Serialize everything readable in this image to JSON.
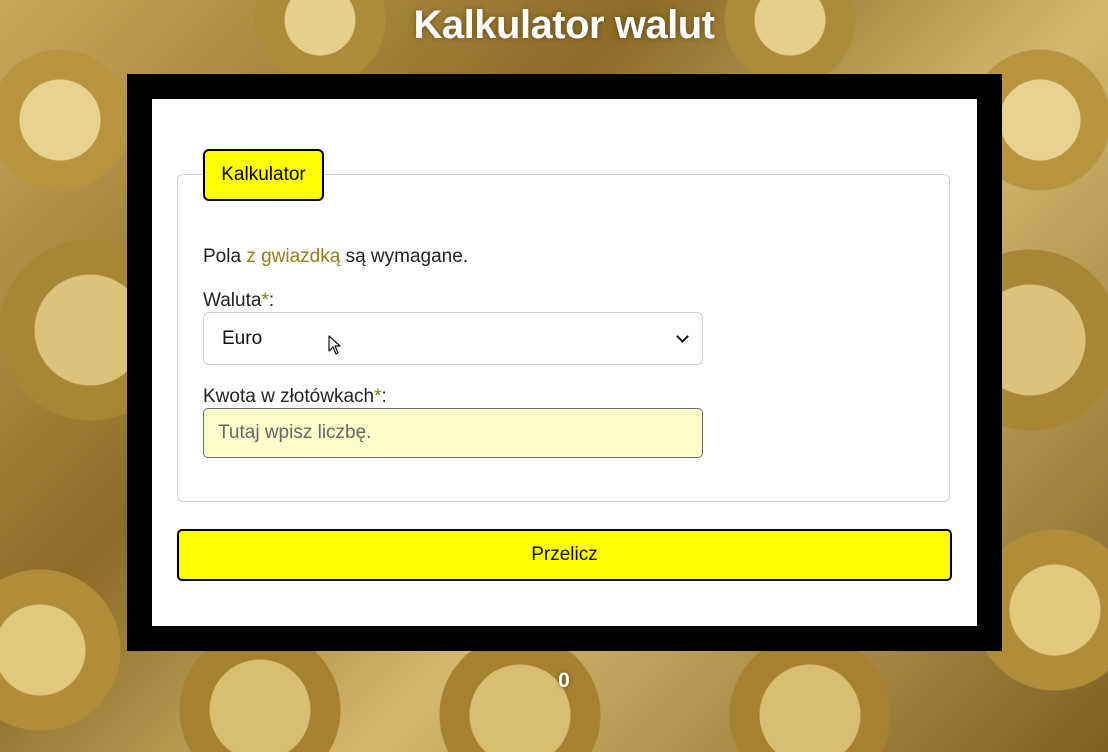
{
  "header": {
    "title": "Kalkulator walut"
  },
  "calculator": {
    "legend": "Kalkulator",
    "required_note": {
      "prefix": "Pola ",
      "highlight": "z gwiazdką",
      "suffix": " są wymagane."
    },
    "currency_field": {
      "label": "Waluta",
      "required_mark": "*",
      "label_suffix": ":",
      "selected_value": "Euro"
    },
    "amount_field": {
      "label": "Kwota w złotówkach",
      "required_mark": "*",
      "label_suffix": ":",
      "placeholder": "Tutaj wpisz liczbę.",
      "value": ""
    },
    "button_label": "Przelicz"
  },
  "result": {
    "value": "0"
  },
  "colors": {
    "accent": "#ffff00",
    "frame": "#000000",
    "hint": "#8f7d1c",
    "input_background": "#fffccc"
  },
  "icons": {
    "dropdown": "chevron-down-icon",
    "pointer": "mouse-pointer-icon"
  }
}
